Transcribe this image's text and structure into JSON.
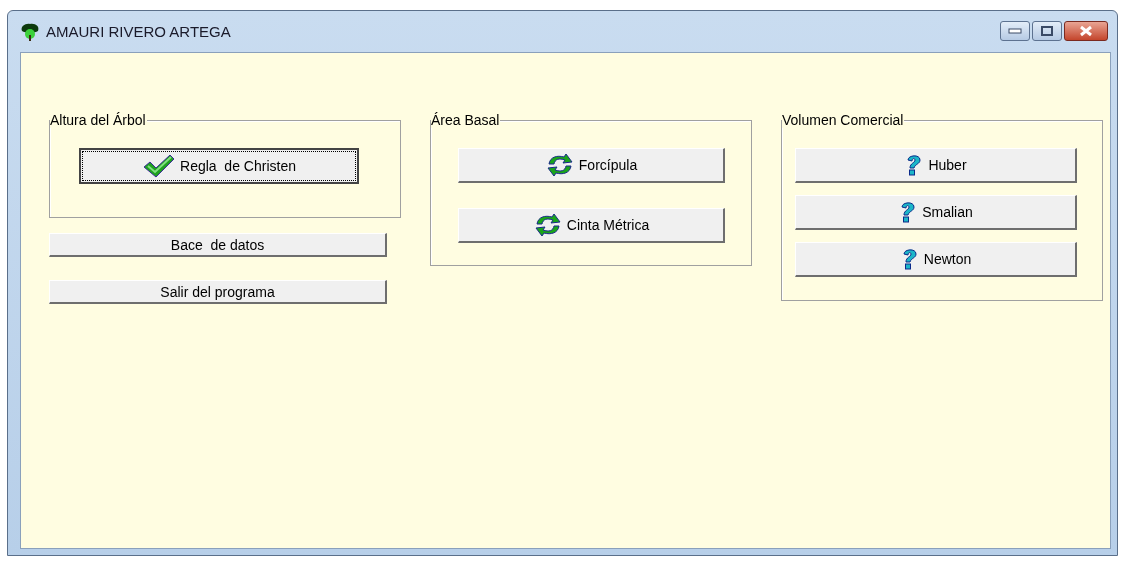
{
  "window": {
    "title": "AMAURI RIVERO ARTEGA"
  },
  "groups": [
    {
      "title": "Altura del Árbol",
      "buttons": [
        {
          "label": "Regla  de Christen",
          "kind": "check",
          "focused": true
        }
      ]
    },
    {
      "title": "Área Basal",
      "buttons": [
        {
          "label": "Forcípula",
          "kind": "refresh",
          "focused": false
        },
        {
          "label": "Cinta Métrica",
          "kind": "refresh",
          "focused": false
        }
      ]
    },
    {
      "title": "Volumen Comercial",
      "buttons": [
        {
          "label": "Huber",
          "kind": "question",
          "focused": false
        },
        {
          "label": "Smalian",
          "kind": "question",
          "focused": false
        },
        {
          "label": "Newton",
          "kind": "question",
          "focused": false
        }
      ]
    }
  ],
  "buttons": [
    {
      "label": "Bace  de datos"
    },
    {
      "label": "Salir del programa"
    }
  ]
}
